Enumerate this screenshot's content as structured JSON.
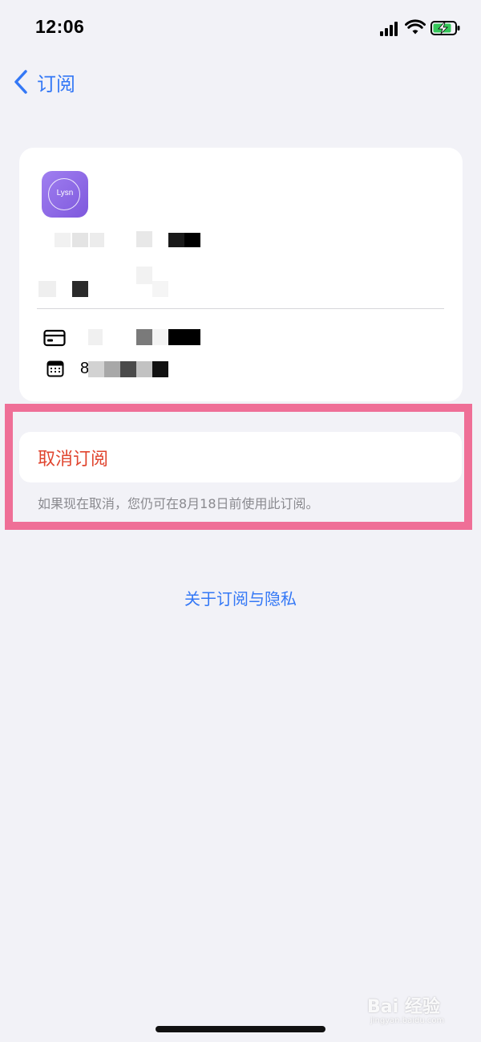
{
  "status_bar": {
    "time": "12:06"
  },
  "nav": {
    "back_label": "订阅"
  },
  "subscription_card": {
    "app_icon_text": "Lysn",
    "renewal_prefix": "8"
  },
  "cancel": {
    "button_label": "取消订阅",
    "note": "如果现在取消，您仍可在8月18日前使用此订阅。"
  },
  "footer": {
    "privacy_link": "关于订阅与隐私"
  },
  "watermark": {
    "main": "Bai 经验",
    "sub": "jingyan.baidu.com"
  },
  "colors": {
    "accent_blue": "#3478f6",
    "destructive_red": "#e0452f",
    "highlight_pink": "#ef6f97",
    "battery_green": "#34c759"
  }
}
